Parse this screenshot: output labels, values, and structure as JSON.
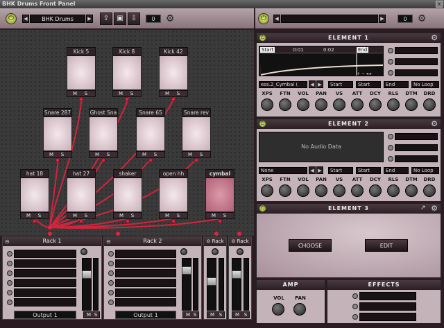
{
  "window": {
    "title": "BHK Drums Front Panel",
    "close": "x"
  },
  "left_top": {
    "kit_name": "BHK Drums",
    "prev": "◀",
    "next": "▶",
    "count": "0",
    "btn1": "⇪",
    "btn2": "▣",
    "btn3": "⇩"
  },
  "right_top": {
    "name": "",
    "prev": "◀",
    "next": "▶",
    "count": "0"
  },
  "pads": [
    {
      "label": "Kick 5"
    },
    {
      "label": "Kick 8"
    },
    {
      "label": "Kick 42"
    },
    {
      "label": "Snare 287"
    },
    {
      "label": "Ghost Sna"
    },
    {
      "label": "Snare 65"
    },
    {
      "label": "Snare rev"
    },
    {
      "label": "hat 18"
    },
    {
      "label": "hat 27"
    },
    {
      "label": "shaker"
    },
    {
      "label": "open hh"
    },
    {
      "label": "cymbal"
    }
  ],
  "mute": "M",
  "solo": "S",
  "racks": [
    {
      "name": "Rack 1",
      "output": "Output 1"
    },
    {
      "name": "Rack 2",
      "output": "Output 1"
    },
    {
      "name": "Rack"
    },
    {
      "name": "Rack"
    }
  ],
  "element1": {
    "title": "ELEMENT 1",
    "markers": [
      "Start",
      "0:01",
      "0:02",
      "End"
    ],
    "file": "ess.2_Cymbal (",
    "start1": "Start",
    "start2": "Start",
    "end": "End",
    "loop": "No Loop",
    "knobs": [
      "XPS",
      "FTN",
      "VOL",
      "PAN",
      "VS",
      "ATT",
      "DCY",
      "RLS",
      "DTM",
      "DRD"
    ]
  },
  "element2": {
    "title": "ELEMENT 2",
    "no_audio": "No Audio Data",
    "file": "None",
    "start1": "Start",
    "start2": "Start",
    "end": "End",
    "loop": "No Loop",
    "knobs": [
      "XPS",
      "FTN",
      "VOL",
      "PAN",
      "VS",
      "ATT",
      "DCY",
      "RLS",
      "DTM",
      "DRD"
    ]
  },
  "element3": {
    "title": "ELEMENT 3",
    "choose": "CHOOSE",
    "edit": "EDIT"
  },
  "amp": {
    "title": "AMP",
    "vol": "VOL",
    "pan": "PAN"
  },
  "effects": {
    "title": "EFFECTS"
  },
  "colors": {
    "accent": "#e3233f",
    "panel": "#c4b4ba",
    "header": "#2a1e24"
  }
}
